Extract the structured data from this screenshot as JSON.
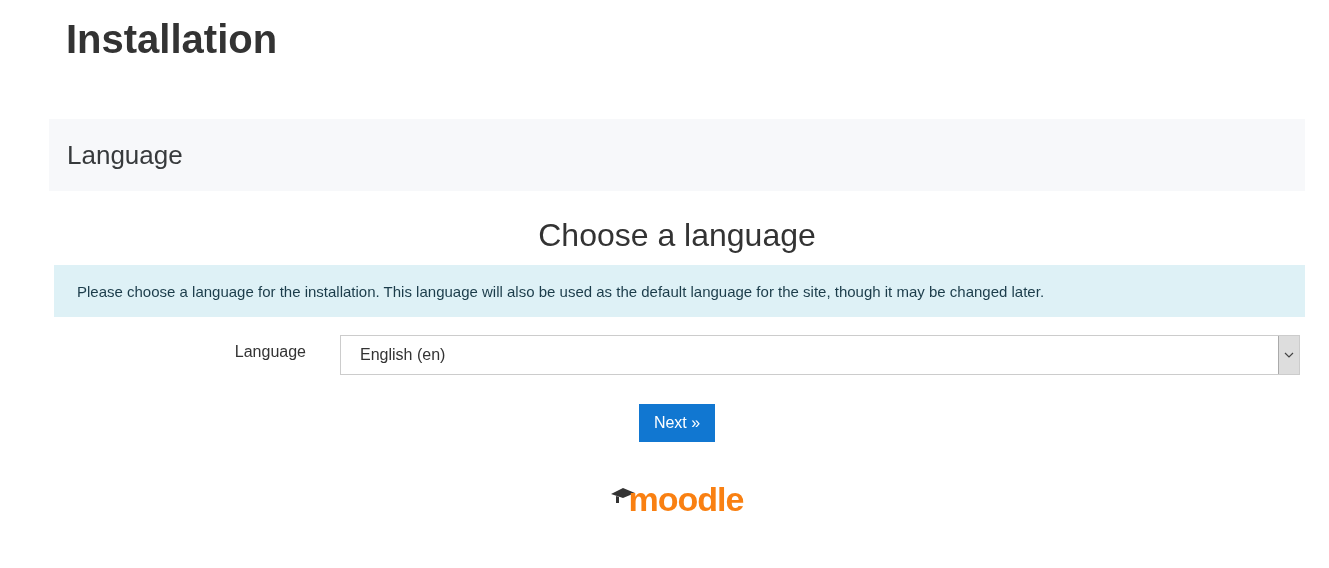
{
  "page_title": "Installation",
  "section": {
    "heading": "Language"
  },
  "subheading": "Choose a language",
  "notice": "Please choose a language for the installation. This language will also be used as the default language for the site, though it may be changed later.",
  "language_field": {
    "label": "Language",
    "value": "English (en)"
  },
  "next_button": "Next »",
  "logo": "moodle"
}
